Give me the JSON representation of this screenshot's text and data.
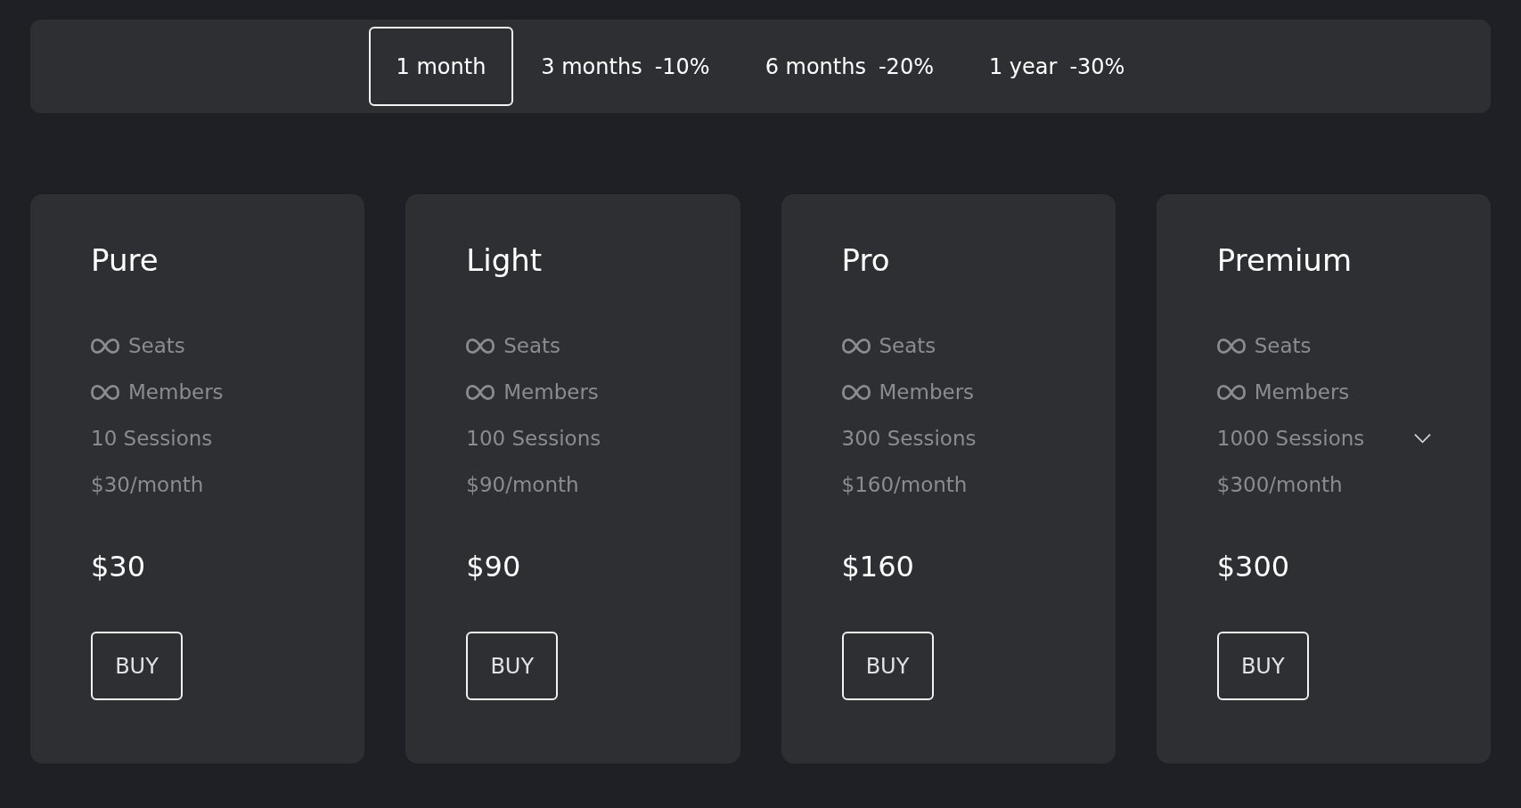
{
  "billing_periods": [
    {
      "label": "1 month",
      "selected": true
    },
    {
      "label": "3 months",
      "discount": "-10%",
      "selected": false
    },
    {
      "label": "6 months",
      "discount": "-20%",
      "selected": false
    },
    {
      "label": "1 year",
      "discount": "-30%",
      "selected": false
    }
  ],
  "plans": [
    {
      "name": "Pure",
      "features": [
        {
          "kind": "unlimited",
          "text": "Seats"
        },
        {
          "kind": "unlimited",
          "text": "Members"
        },
        {
          "kind": "text",
          "text": "10 Sessions"
        },
        {
          "kind": "text",
          "text": "$30/month"
        }
      ],
      "price": "$30",
      "button": "BUY"
    },
    {
      "name": "Light",
      "features": [
        {
          "kind": "unlimited",
          "text": "Seats"
        },
        {
          "kind": "unlimited",
          "text": "Members"
        },
        {
          "kind": "text",
          "text": "100 Sessions"
        },
        {
          "kind": "text",
          "text": "$90/month"
        }
      ],
      "price": "$90",
      "button": "BUY"
    },
    {
      "name": "Pro",
      "features": [
        {
          "kind": "unlimited",
          "text": "Seats"
        },
        {
          "kind": "unlimited",
          "text": "Members"
        },
        {
          "kind": "text",
          "text": "300 Sessions"
        },
        {
          "kind": "text",
          "text": "$160/month"
        }
      ],
      "price": "$160",
      "button": "BUY"
    },
    {
      "name": "Premium",
      "features": [
        {
          "kind": "unlimited",
          "text": "Seats"
        },
        {
          "kind": "unlimited",
          "text": "Members"
        },
        {
          "kind": "select",
          "text": "1000 Sessions"
        },
        {
          "kind": "text",
          "text": "$300/month"
        }
      ],
      "price": "$300",
      "button": "BUY"
    }
  ]
}
